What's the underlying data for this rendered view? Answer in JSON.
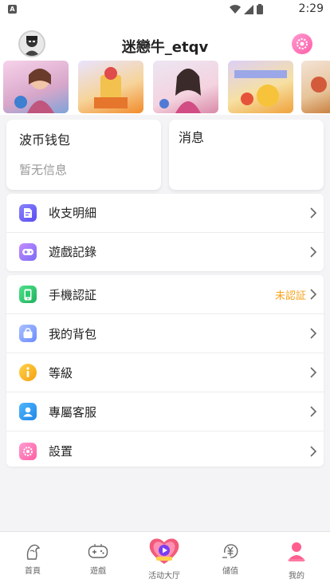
{
  "status_bar": {
    "time": "2:29"
  },
  "header": {
    "username": "迷戀牛_etqv"
  },
  "banner": {
    "items": [
      {
        "icon": "game-banner-1",
        "color": "#f3c9e4"
      },
      {
        "icon": "game-banner-2",
        "color": "#f6d9a7"
      },
      {
        "icon": "game-banner-3",
        "color": "#e9c7d8"
      },
      {
        "icon": "game-banner-4",
        "color": "#d7c7f3"
      },
      {
        "icon": "game-banner-5",
        "color": "#f6e2c9"
      }
    ]
  },
  "wallet": {
    "title": "波币钱包",
    "subtitle": "暂无信息"
  },
  "messages": {
    "title": "消息"
  },
  "menu": {
    "group1": [
      {
        "label": "收支明細",
        "icon": "receipt-icon",
        "color": "#6c63ff"
      },
      {
        "label": "遊戲記錄",
        "icon": "gamepad-icon",
        "color": "#9f6cf6"
      }
    ],
    "group2": [
      {
        "label": "手機認証",
        "icon": "phone-icon",
        "color": "#2ecc71",
        "badge": "未認証"
      },
      {
        "label": "我的背包",
        "icon": "bag-icon",
        "color": "#7d9bff"
      },
      {
        "label": "等級",
        "icon": "info-icon",
        "color": "#f7b21b"
      },
      {
        "label": "專屬客服",
        "icon": "user-icon",
        "color": "#2d9bf0"
      },
      {
        "label": "設置",
        "icon": "settings-icon",
        "color": "#ff6fb0"
      }
    ]
  },
  "nav": [
    {
      "label": "首頁",
      "icon": "home-icon"
    },
    {
      "label": "遊戲",
      "icon": "game-icon"
    },
    {
      "label": "活动大厅",
      "icon": "activity-hall-icon"
    },
    {
      "label": "儲值",
      "icon": "deposit-icon"
    },
    {
      "label": "我的",
      "icon": "profile-icon",
      "active": true
    }
  ]
}
